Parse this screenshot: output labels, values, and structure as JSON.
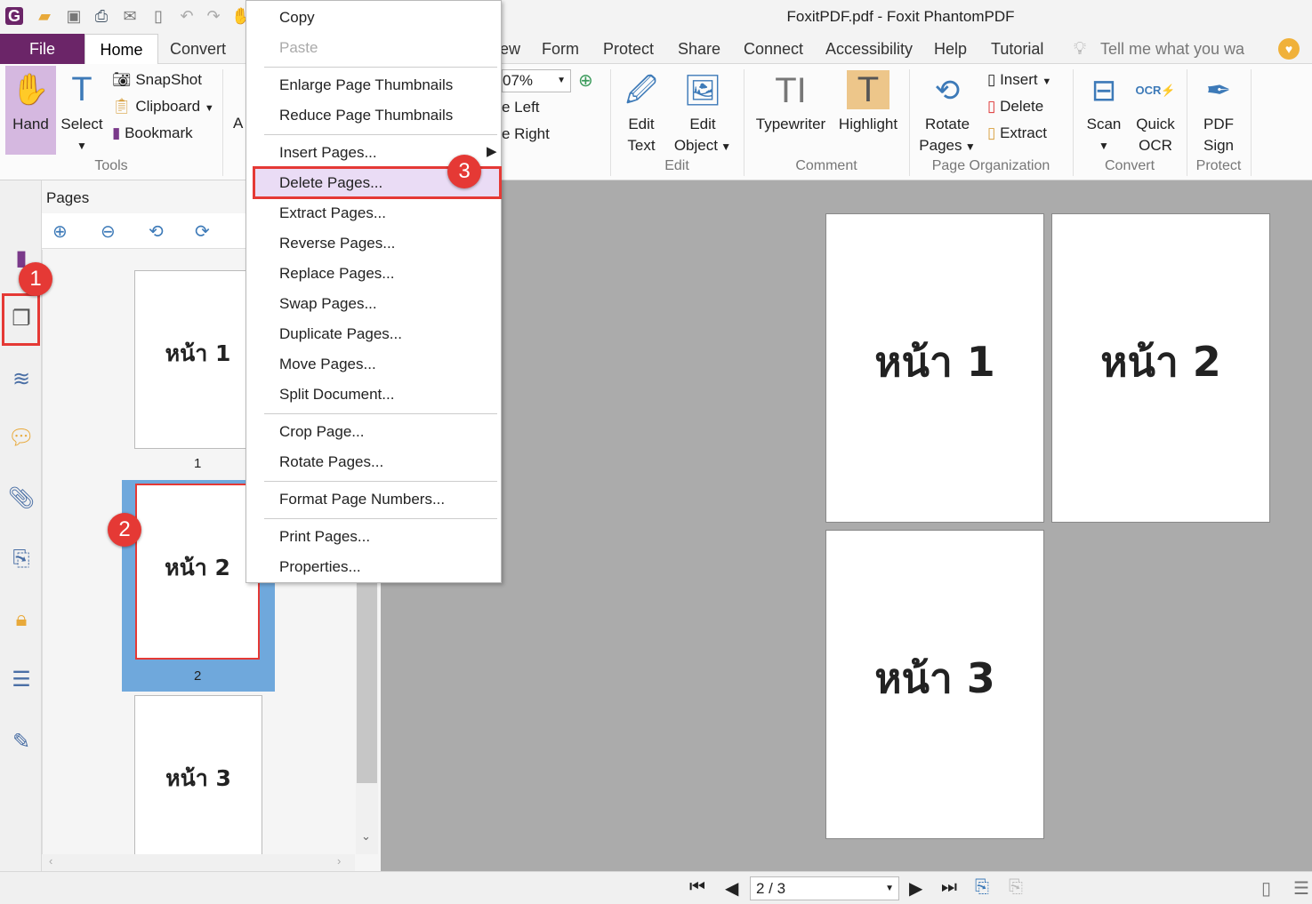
{
  "window": {
    "title": "FoxitPDF.pdf - Foxit PhantomPDF"
  },
  "tabs": [
    "File",
    "Home",
    "Convert",
    "ew",
    "Form",
    "Protect",
    "Share",
    "Connect",
    "Accessibility",
    "Help",
    "Tutorial"
  ],
  "tell_me": {
    "placeholder": "Tell me what you wa"
  },
  "ribbon": {
    "tools": {
      "hand": "Hand",
      "select": "Select",
      "snapshot": "SnapShot",
      "clipboard": "Clipboard",
      "bookmark": "Bookmark",
      "group": "Tools"
    },
    "partial": {
      "a": "A",
      "zoom": "07%",
      "rotate_left": "e Left",
      "rotate_right": "e Right"
    },
    "edit": {
      "edit_text_1": "Edit",
      "edit_text_2": "Text",
      "edit_object_1": "Edit",
      "edit_object_2": "Object",
      "group": "Edit"
    },
    "comment": {
      "typewriter": "Typewriter",
      "highlight": "Highlight",
      "group": "Comment"
    },
    "page_org": {
      "rotate_1": "Rotate",
      "rotate_2": "Pages",
      "insert": "Insert",
      "delete": "Delete",
      "extract": "Extract",
      "group": "Page Organization"
    },
    "convert": {
      "scan": "Scan",
      "ocr_1": "Quick",
      "ocr_2": "OCR",
      "group": "Convert"
    },
    "protect": {
      "sign_1": "PDF",
      "sign_2": "Sign",
      "group": "Protect"
    }
  },
  "pages_panel": {
    "title": "Pages",
    "thumbnails": [
      {
        "text": "หน้า 1",
        "label": "1"
      },
      {
        "text": "หน้า 2",
        "label": "2"
      },
      {
        "text": "หน้า 3",
        "label": ""
      }
    ]
  },
  "document": {
    "pages": [
      "หน้า 1",
      "หน้า 2",
      "หน้า 3"
    ]
  },
  "context_menu": {
    "items": [
      "Copy",
      "Paste",
      "Enlarge Page Thumbnails",
      "Reduce Page Thumbnails",
      "Insert Pages...",
      "Delete Pages...",
      "Extract Pages...",
      "Reverse Pages...",
      "Replace Pages...",
      "Swap Pages...",
      "Duplicate Pages...",
      "Move Pages...",
      "Split Document...",
      "Crop Page...",
      "Rotate Pages...",
      "Format Page Numbers...",
      "Print Pages...",
      "Properties..."
    ],
    "disabled": [
      "Paste"
    ],
    "highlighted": "Delete Pages..."
  },
  "callouts": [
    "1",
    "2",
    "3"
  ],
  "statusbar": {
    "page_indicator": "2 / 3"
  },
  "colors": {
    "file_tab": "#6b2568",
    "callout": "#e53935",
    "selection": "#6fa8dc",
    "menu_highlight": "#eadcf5",
    "main_bg": "#ababab"
  }
}
